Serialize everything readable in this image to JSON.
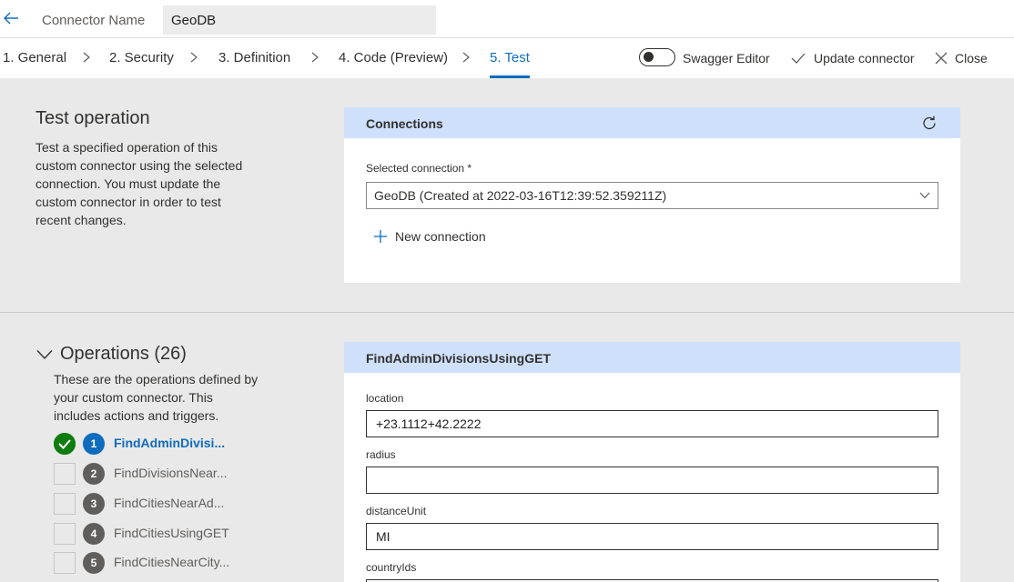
{
  "header": {
    "connector_name_label": "Connector Name",
    "connector_name_value": "GeoDB"
  },
  "wizard": {
    "steps": [
      {
        "label": "1. General"
      },
      {
        "label": "2. Security"
      },
      {
        "label": "3. Definition"
      },
      {
        "label": "4. Code (Preview)"
      },
      {
        "label": "5. Test",
        "active": true
      }
    ],
    "swagger_toggle_label": "Swagger Editor",
    "swagger_toggle_on": false,
    "update_label": "Update connector",
    "close_label": "Close"
  },
  "test_operation": {
    "title": "Test operation",
    "description": "Test a specified operation of this custom connector using the selected connection. You must update the custom connector in order to test recent changes."
  },
  "connections": {
    "title": "Connections",
    "selected_label": "Selected connection *",
    "selected_value": "GeoDB (Created at 2022-03-16T12:39:52.359211Z)",
    "new_connection_label": "New connection"
  },
  "operations": {
    "title": "Operations (26)",
    "description": "These are the operations defined by your custom connector. This includes actions and triggers.",
    "items": [
      {
        "num": "1",
        "name": "FindAdminDivisi...",
        "active": true,
        "tested": true
      },
      {
        "num": "2",
        "name": "FindDivisionsNear..."
      },
      {
        "num": "3",
        "name": "FindCitiesNearAd..."
      },
      {
        "num": "4",
        "name": "FindCitiesUsingGET"
      },
      {
        "num": "5",
        "name": "FindCitiesNearCity..."
      }
    ]
  },
  "operation_panel": {
    "title": "FindAdminDivisionsUsingGET",
    "params": [
      {
        "label": "location",
        "value": "+23.1112+42.2222"
      },
      {
        "label": "radius",
        "value": ""
      },
      {
        "label": "distanceUnit",
        "value": "MI"
      },
      {
        "label": "countryIds",
        "value": ""
      }
    ]
  },
  "colors": {
    "accent": "#0f6cbd",
    "panel_header": "#cfe0fb",
    "success": "#107c10",
    "background": "#e9e9e9"
  }
}
